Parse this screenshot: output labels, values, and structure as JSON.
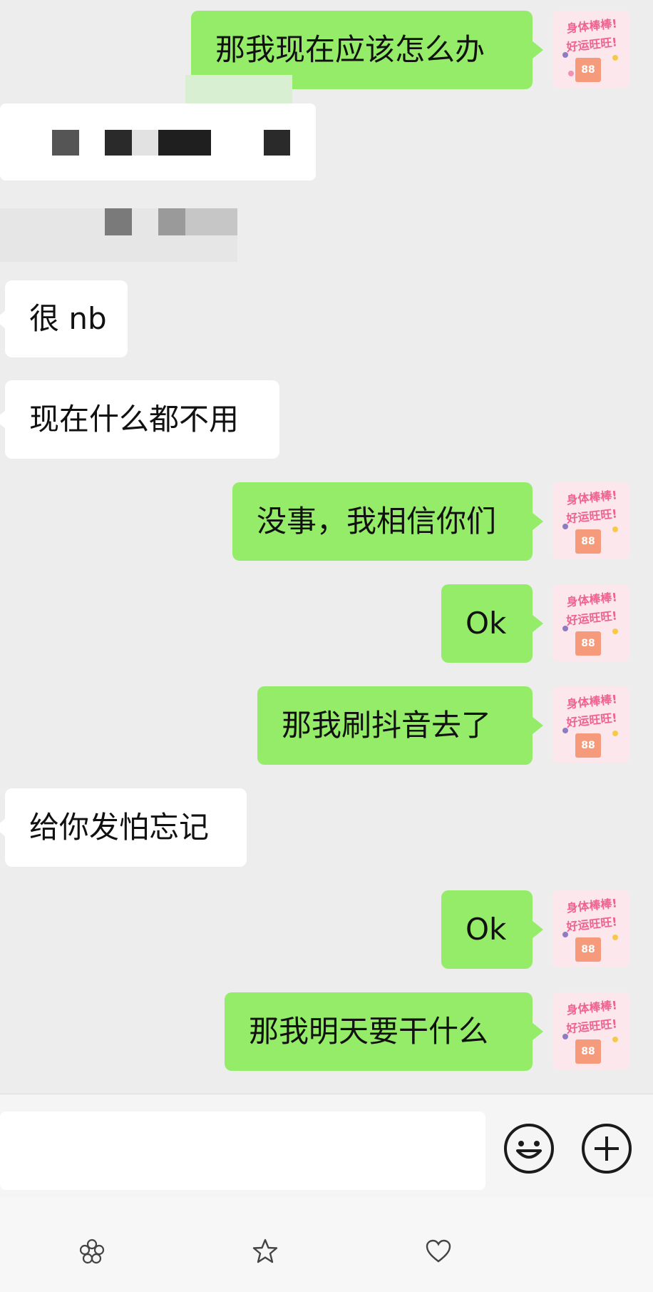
{
  "messages": [
    {
      "sender": "me",
      "text": "那我现在应该怎么办"
    },
    {
      "sender": "them",
      "text": "很 nb"
    },
    {
      "sender": "them",
      "text": "现在什么都不用"
    },
    {
      "sender": "me",
      "text": "没事，我相信你们"
    },
    {
      "sender": "me",
      "text": "Ok"
    },
    {
      "sender": "me",
      "text": "那我刷抖音去了"
    },
    {
      "sender": "them",
      "text": "给你发怕忘记"
    },
    {
      "sender": "me",
      "text": "Ok"
    },
    {
      "sender": "me",
      "text": "那我明天要干什么"
    }
  ],
  "avatar": {
    "line1": "身体棒棒!",
    "line2": "好运旺旺!",
    "badge": "88"
  },
  "input": {
    "value": "",
    "placeholder": ""
  },
  "icons": {
    "emoji": "emoji-icon",
    "plus": "plus-icon",
    "nav": [
      "flower-icon",
      "star-icon",
      "heart-icon"
    ]
  },
  "colors": {
    "me_bubble": "#95ec69",
    "them_bubble": "#ffffff",
    "chat_bg": "#ededed",
    "avatar_text": "#f06292"
  }
}
